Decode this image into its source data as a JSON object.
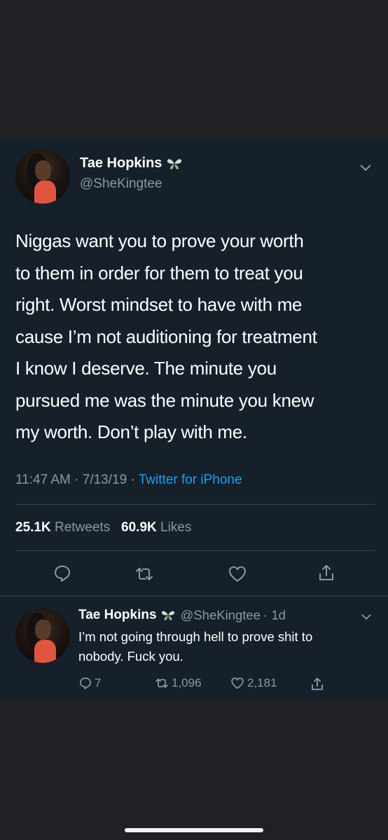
{
  "tweet": {
    "author_name": "Tae Hopkins",
    "author_handle": "@SheKingtee",
    "badge_icon": "butterfly-icon",
    "text_lines": [
      "Niggas want you to prove your worth",
      "to them in order for them to treat you",
      "right. Worst mindset to have with me",
      "cause I’m not auditioning for treatment",
      "I know I deserve. The minute you",
      "pursued me was the minute you knew",
      "my worth. Don’t play with me."
    ],
    "time": "11:47 AM",
    "date": "7/13/19",
    "separator": "·",
    "source": "Twitter for iPhone",
    "retweets_count": "25.1K",
    "retweets_label": "Retweets",
    "likes_count": "60.9K",
    "likes_label": "Likes",
    "actions": [
      "reply-icon",
      "retweet-icon",
      "like-icon",
      "share-icon"
    ]
  },
  "reply": {
    "author_name": "Tae Hopkins",
    "author_handle": "@SheKingtee",
    "age": "· 1d",
    "text_lines": [
      "I’m not going through hell to prove shit to",
      "nobody. Fuck you."
    ],
    "replies_count": "7",
    "retweets_count": "1,096",
    "likes_count": "2,181"
  },
  "colors": {
    "page_background": "#202124",
    "card_background": "#15202b",
    "text_primary": "#ffffff",
    "text_secondary": "#8899a6",
    "link": "#1da1f2",
    "divider": "#38444d"
  }
}
